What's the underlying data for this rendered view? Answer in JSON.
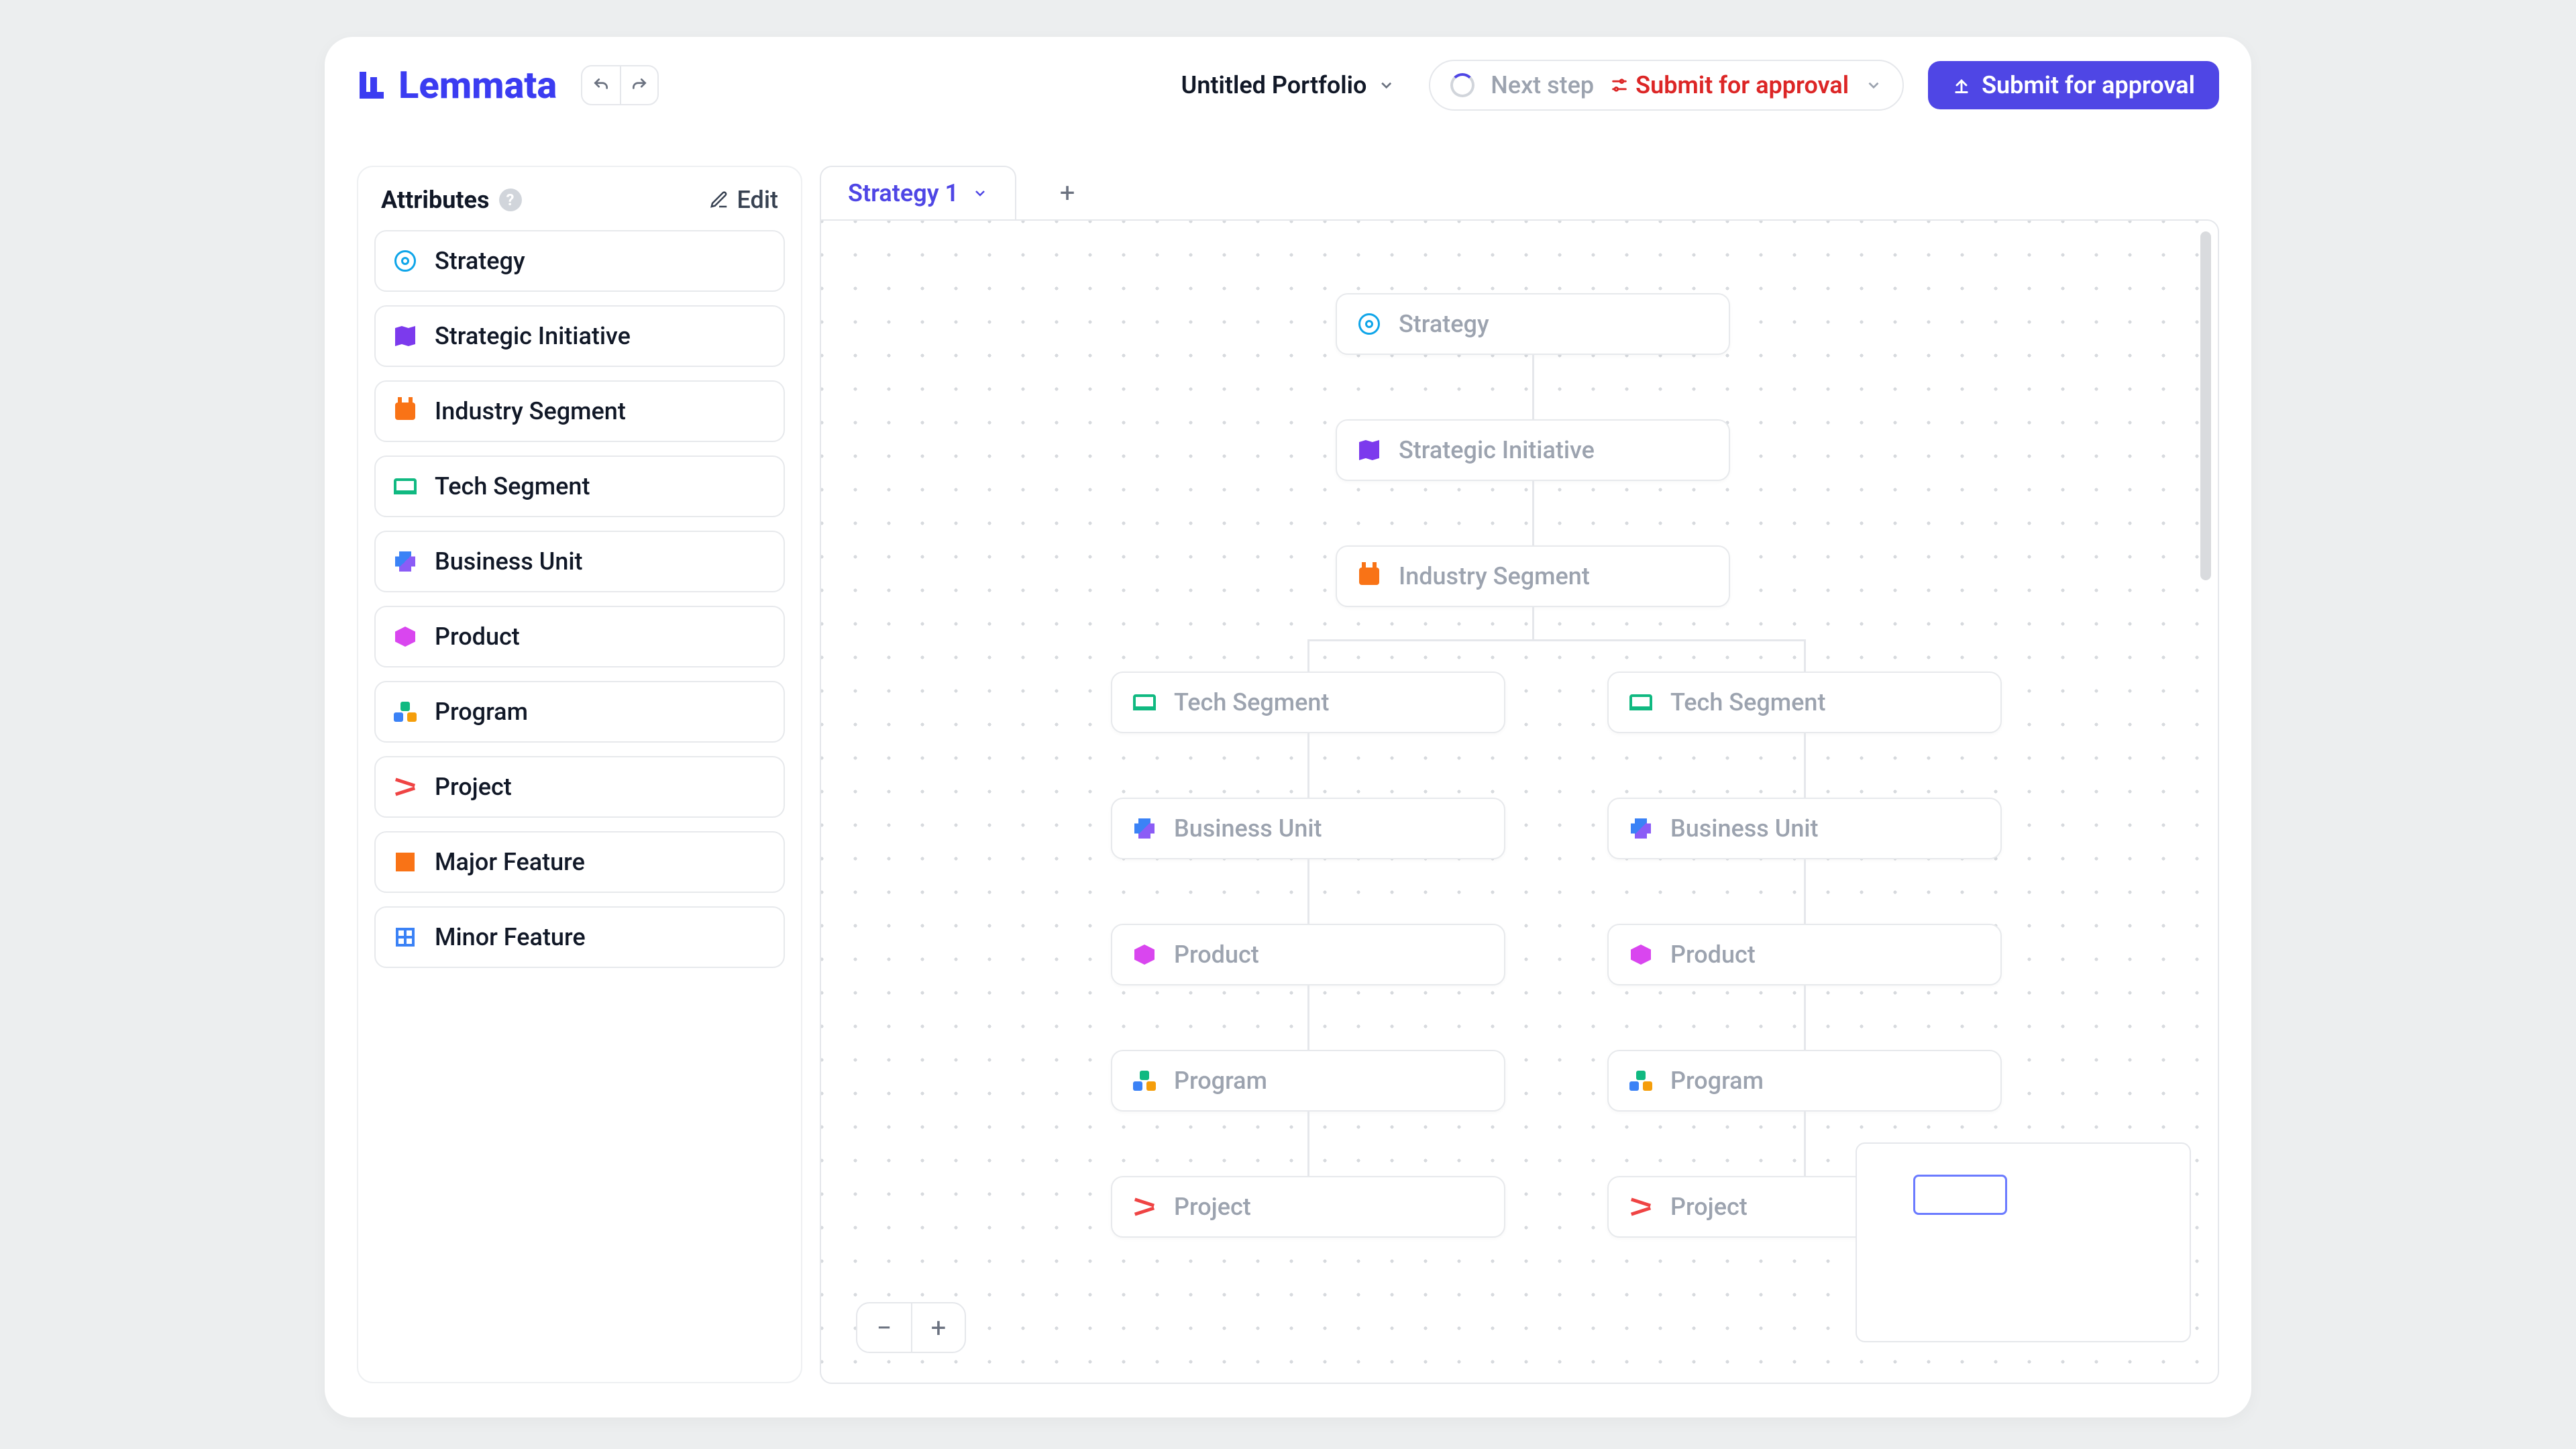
{
  "brand": {
    "name": "Lemmata"
  },
  "header": {
    "portfolio_title": "Untitled Portfolio",
    "next_step_label": "Next step",
    "next_step_action": "Submit for approval",
    "submit_button": "Submit for approval"
  },
  "sidebar": {
    "title": "Attributes",
    "edit_label": "Edit",
    "items": [
      {
        "label": "Strategy",
        "icon": "target"
      },
      {
        "label": "Strategic Initiative",
        "icon": "map"
      },
      {
        "label": "Industry Segment",
        "icon": "industry"
      },
      {
        "label": "Tech Segment",
        "icon": "laptop"
      },
      {
        "label": "Business Unit",
        "icon": "puzzle"
      },
      {
        "label": "Product",
        "icon": "cube"
      },
      {
        "label": "Program",
        "icon": "cluster"
      },
      {
        "label": "Project",
        "icon": "arrows"
      },
      {
        "label": "Major Feature",
        "icon": "grid4"
      },
      {
        "label": "Minor Feature",
        "icon": "grid4b"
      }
    ]
  },
  "tabs": {
    "active": "Strategy 1"
  },
  "canvas": {
    "nodes_center": [
      {
        "label": "Strategy",
        "icon": "target"
      },
      {
        "label": "Strategic Initiative",
        "icon": "map"
      },
      {
        "label": "Industry Segment",
        "icon": "industry"
      }
    ],
    "nodes_left": [
      {
        "label": "Tech Segment",
        "icon": "laptop"
      },
      {
        "label": "Business Unit",
        "icon": "puzzle"
      },
      {
        "label": "Product",
        "icon": "cube"
      },
      {
        "label": "Program",
        "icon": "cluster"
      },
      {
        "label": "Project",
        "icon": "arrows"
      }
    ],
    "nodes_right": [
      {
        "label": "Tech Segment",
        "icon": "laptop"
      },
      {
        "label": "Business Unit",
        "icon": "puzzle"
      },
      {
        "label": "Product",
        "icon": "cube"
      },
      {
        "label": "Program",
        "icon": "cluster"
      },
      {
        "label": "Project",
        "icon": "arrows"
      }
    ]
  }
}
